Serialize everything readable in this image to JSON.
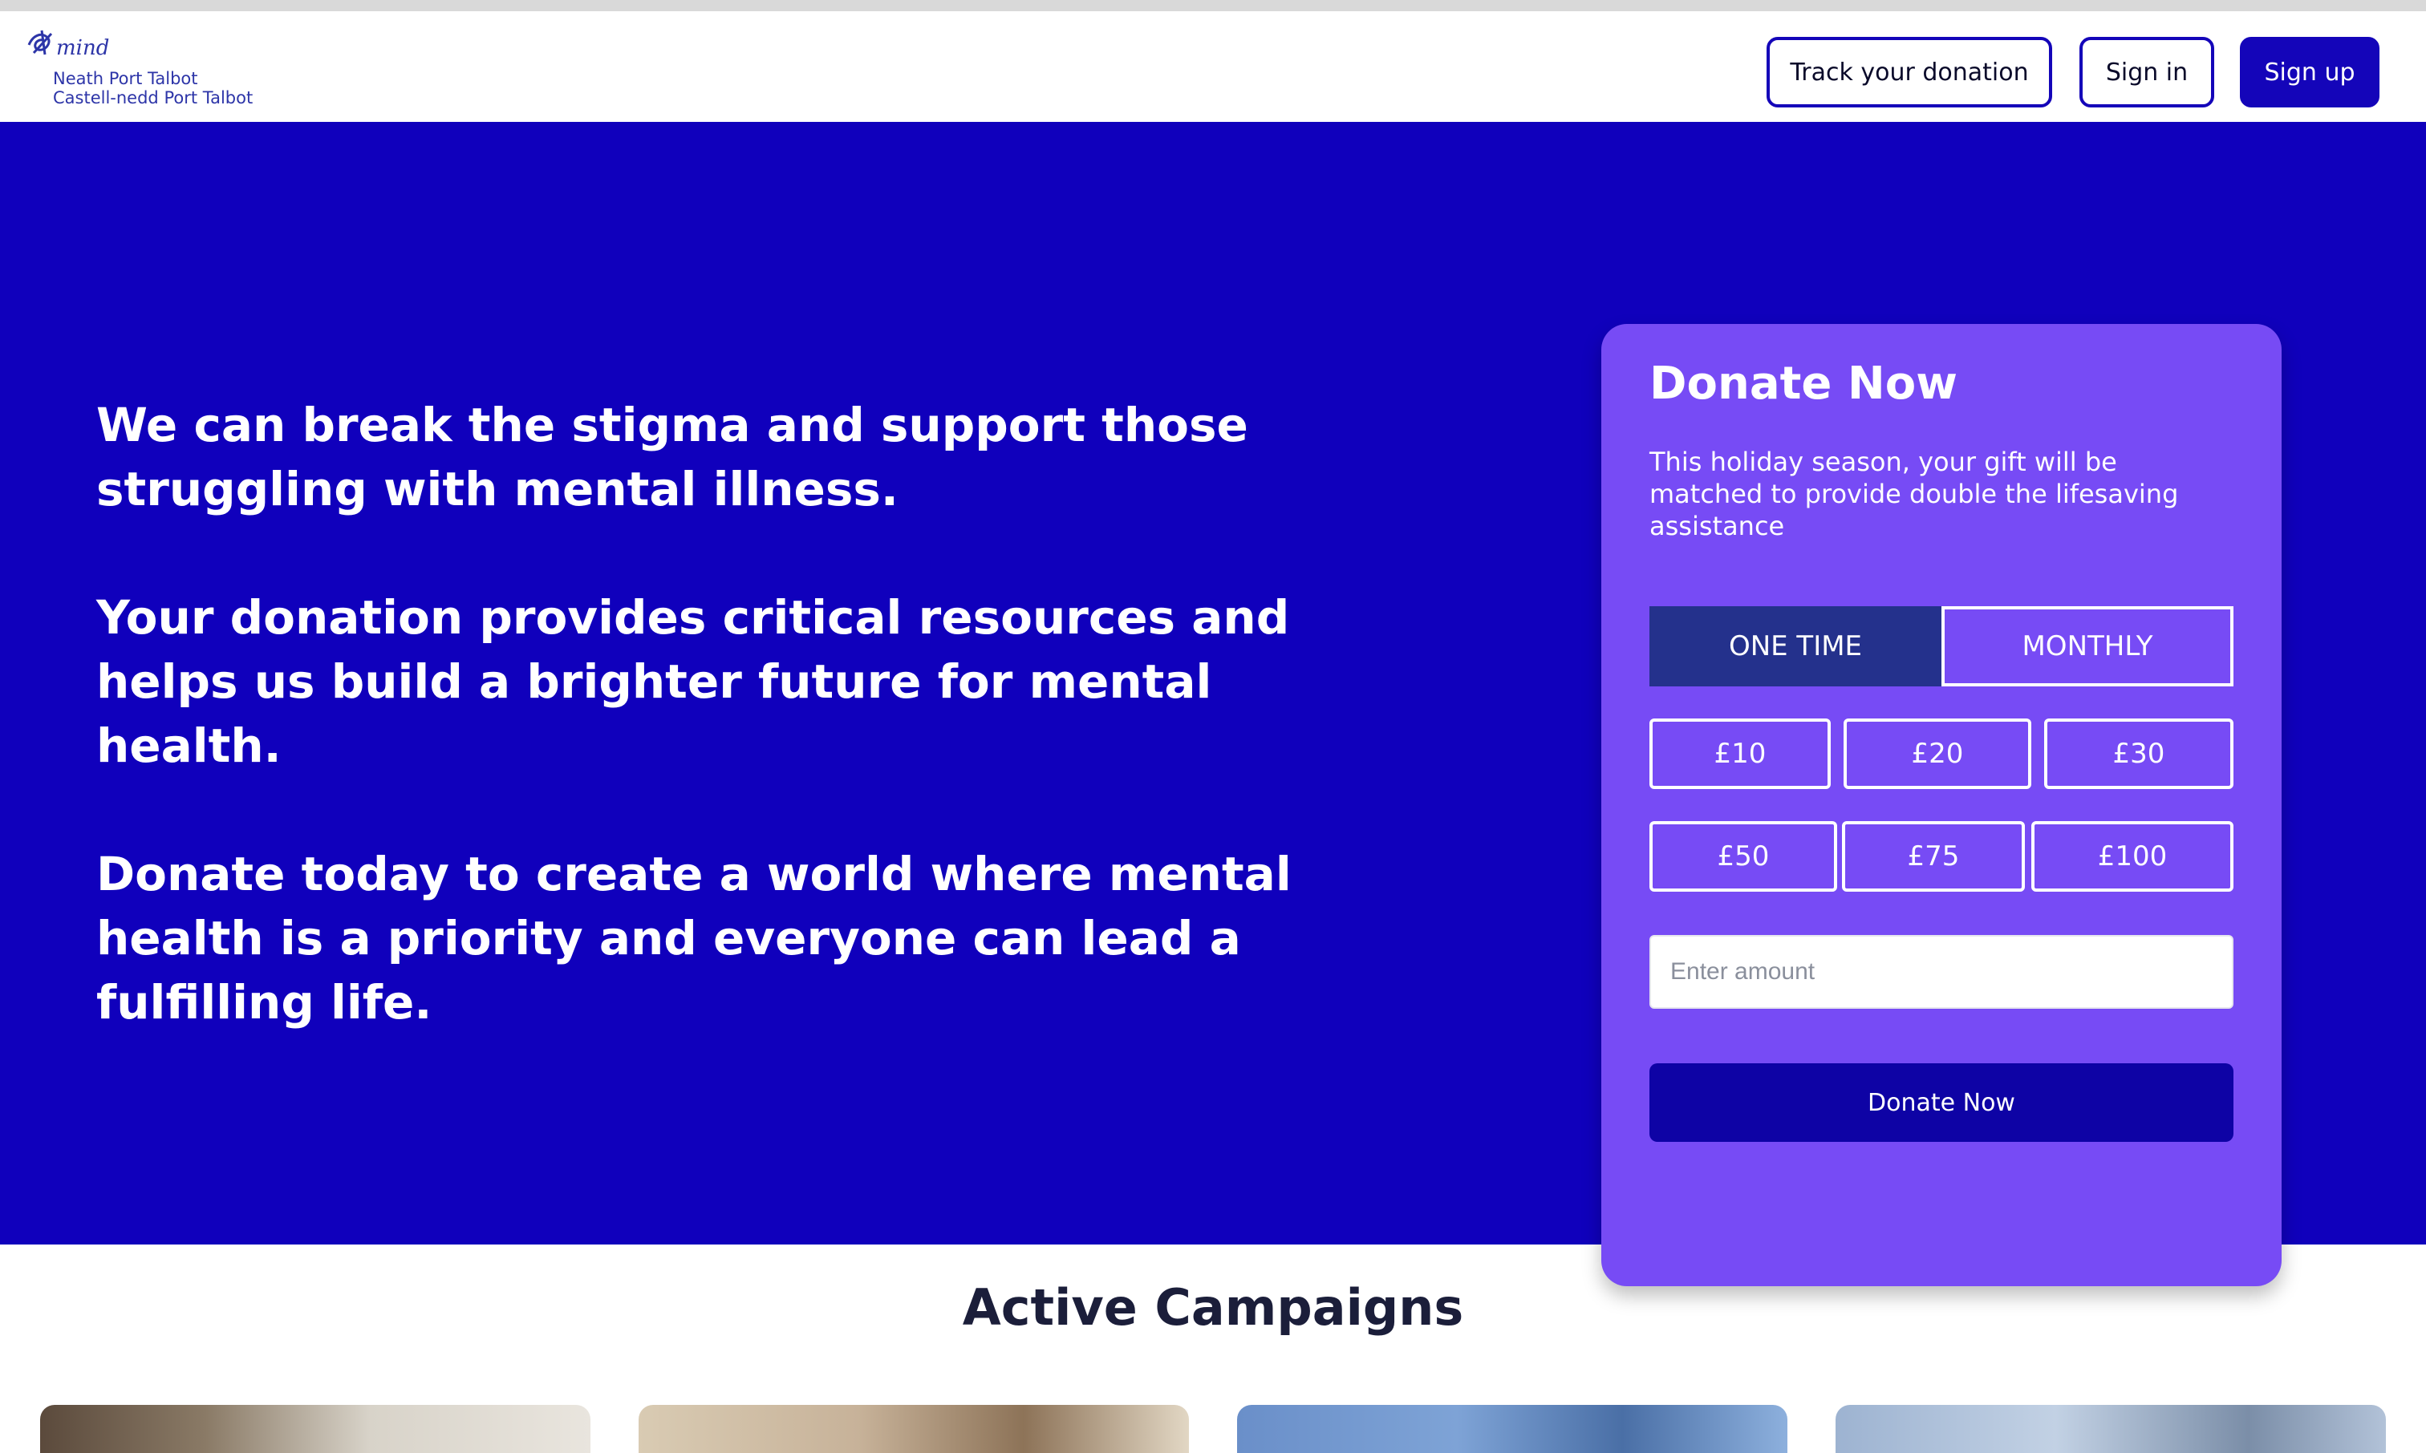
{
  "header": {
    "logo_text": "mind",
    "logo_line1": "Neath Port Talbot",
    "logo_line2": "Castell-nedd Port Talbot",
    "track_label": "Track your donation",
    "signin_label": "Sign in",
    "signup_label": "Sign up"
  },
  "hero": {
    "paragraphs": [
      "We can break the stigma and support those struggling with mental illness.",
      "Your donation provides critical resources and helps us build a brighter future for mental health.",
      "Donate today to create a world where mental health is a priority and everyone can lead a fulfilling life."
    ]
  },
  "donate": {
    "title": "Donate Now",
    "subtitle": "This holiday season, your gift will be matched to provide double the lifesaving assistance",
    "frequency": {
      "options": [
        "ONE TIME",
        "MONTHLY"
      ],
      "selected": "ONE TIME"
    },
    "amounts": [
      "£10",
      "£20",
      "£30",
      "£50",
      "£75",
      "£100"
    ],
    "input_placeholder": "Enter amount",
    "input_value": "",
    "submit_label": "Donate Now"
  },
  "campaigns": {
    "title": "Active Campaigns",
    "count_visible": 4
  },
  "colors": {
    "brand_primary": "#1000bc",
    "card_bg": "#774bf5",
    "selected_toggle": "#24318c",
    "donate_button": "#0e03a5"
  }
}
